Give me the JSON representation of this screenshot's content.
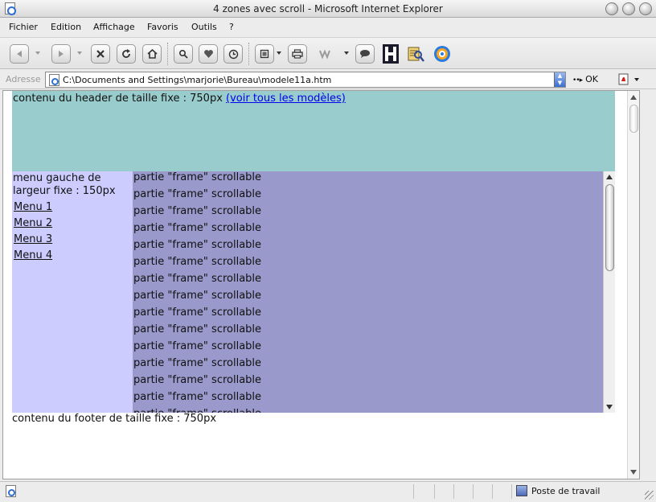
{
  "window": {
    "title": "4 zones avec scroll - Microsoft Internet Explorer"
  },
  "menu": {
    "items": [
      "Fichier",
      "Edition",
      "Affichage",
      "Favoris",
      "Outils",
      "?"
    ]
  },
  "toolbar": {
    "icons": [
      "back-icon",
      "forward-icon",
      "stop-icon",
      "refresh-icon",
      "home-icon",
      "search-icon",
      "favorites-icon",
      "history-icon",
      "print-icon",
      "mail-icon",
      "discuss-icon",
      "h-icon",
      "research-icon",
      "messenger-icon"
    ]
  },
  "address": {
    "label": "Adresse",
    "value": "C:\\Documents and Settings\\marjorie\\Bureau\\modele11a.htm",
    "go_label": "OK"
  },
  "page": {
    "header_text": "contenu du header de taille fixe : 750px ",
    "header_link": "(voir tous les modèles)",
    "menu_description": "menu gauche de largeur fixe : 150px",
    "menu_links": [
      "Menu 1",
      "Menu 2",
      "Menu 3",
      "Menu 4"
    ],
    "frame_line": "partie \"frame\" scrollable",
    "footer_text": "contenu du footer de taille fixe : 750px",
    "colors": {
      "header_bg": "#99cccc",
      "menu_bg": "#ccccff",
      "frame_bg": "#9999cc"
    }
  },
  "status": {
    "zone": "Poste de travail"
  }
}
